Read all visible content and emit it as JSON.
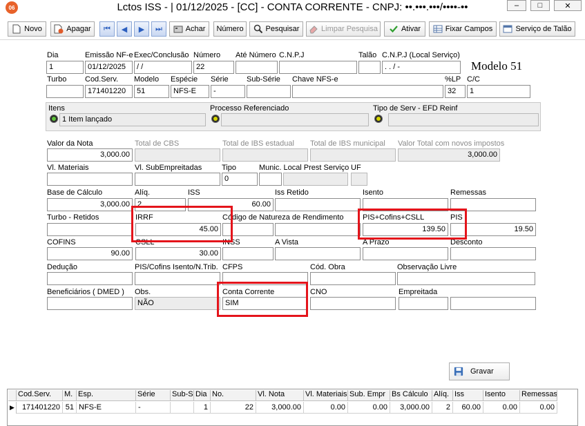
{
  "window": {
    "title": "Lctos ISS - |  01/12/2025 - [CC] - CONTA CORRENTE - CNPJ: ••.•••.•••/••••-••",
    "icon_label": "06",
    "minimize": "–",
    "maximize": "□",
    "close": "✕"
  },
  "toolbar": {
    "novo": "Novo",
    "apagar": "Apagar",
    "achar": "Achar",
    "numero": "Número",
    "pesquisar": "Pesquisar",
    "limpar": "Limpar Pesquisa",
    "ativar": "Ativar",
    "fixar": "Fixar Campos",
    "servico": "Serviço de Talão",
    "nav_first": "⏮",
    "nav_prev": "◀",
    "nav_next": "▶",
    "nav_last": "⏭"
  },
  "header": {
    "modelo_title": "Modelo 51",
    "labels": {
      "dia": "Dia",
      "emissao": "Emissão NF-e",
      "exec": "Exec/Conclusão",
      "numero": "Número",
      "ate_numero": "Até Número",
      "cnpj": "C.N.P.J",
      "talao": "Talão",
      "cnpj_local": "C.N.P.J (Local Serviço)",
      "turbo": "Turbo",
      "cod_serv": "Cod.Serv.",
      "modelo": "Modelo",
      "especie": "Espécie",
      "serie": "Série",
      "sub_serie": "Sub-Série",
      "chave": "Chave NFS-e",
      "plp": "%LP",
      "cc": "C/C"
    },
    "values": {
      "dia": "1",
      "emissao": "01/12/2025",
      "exec": " /  /",
      "numero": "22",
      "ate_numero": "",
      "cnpj": "",
      "talao": "",
      "cnpj_local": "  .    .    /    -",
      "turbo": "",
      "cod_serv": "171401220",
      "modelo": "51",
      "especie": "NFS-E",
      "serie": "-",
      "sub_serie": "",
      "chave": "",
      "plp": "32",
      "cc": "1"
    }
  },
  "itens": {
    "itens_label": "Itens",
    "itens_value": "1 Item lançado",
    "processo_label": "Processo Referenciado",
    "processo_value": "",
    "tipo_label": "Tipo de Serv - EFD Reinf",
    "tipo_value": ""
  },
  "totais": {
    "valor_nota_label": "Valor da Nota",
    "valor_nota": "3,000.00",
    "cbs_label": "Total de CBS",
    "cbs": "",
    "ibs_est_label": "Total de IBS estadual",
    "ibs_est": "",
    "ibs_mun_label": "Total de IBS municipal",
    "ibs_mun": "",
    "total_novos_label": "Valor Total com novos impostos",
    "total_novos": "3,000.00",
    "vl_mat_label": "Vl. Materiais",
    "vl_mat": "",
    "vl_sub_label": "Vl. SubEmpreitadas",
    "vl_sub": "",
    "tipo_label": "Tipo",
    "tipo": "0",
    "munic_label": "Munic. Local Prest Serviço",
    "munic": "",
    "uf_label": "UF",
    "uf": "",
    "base_label": "Base de Cálculo",
    "base": "3,000.00",
    "aliq_label": "Alíq.",
    "aliq": "2",
    "iss_label": "ISS",
    "iss": "60.00",
    "iss_retido_label": "Iss Retido",
    "iss_retido": "",
    "isento_label": "Isento",
    "isento": "",
    "remessas_label": "Remessas",
    "remessas": "",
    "turbo_ret_label": "Turbo - Retidos",
    "turbo_ret": "",
    "irrf_label": "IRRF",
    "irrf": "45.00",
    "cod_nat_label": "Código de Natureza de Rendimento",
    "cod_nat": "",
    "pcc_label": "PIS+Cofins+CSLL",
    "pcc": "139.50",
    "pis_label": "PIS",
    "pis": "19.50",
    "cofins_label": "COFINS",
    "cofins": "90.00",
    "csll_label": "CSLL",
    "csll": "30.00",
    "inss_label": "INSS",
    "inss": "",
    "avista_label": "A Vista",
    "avista": "",
    "aprazo_label": "A Prazo",
    "aprazo": "",
    "desconto_label": "Desconto",
    "desconto": "",
    "deducao_label": "Dedução",
    "deducao": "",
    "pis_isento_label": "PIS/Cofins Isento/N.Trib.",
    "pis_isento": "",
    "cfps_label": "CFPS",
    "cfps": "",
    "cod_obra_label": "Cód. Obra",
    "cod_obra": "",
    "obs_livre_label": "Observação Livre",
    "obs_livre": "",
    "benef_label": "Beneficiários ( DMED )",
    "benef": "",
    "obs_label": "Obs.",
    "obs": "NÃO",
    "conta_label": "Conta Corrente",
    "conta": "SIM",
    "cno_label": "CNO",
    "cno": "",
    "empreitada_label": "Empreitada",
    "empreitada": "",
    "empreitada2": ""
  },
  "actions": {
    "gravar": "Gravar"
  },
  "grid": {
    "columns": [
      "Cod.Serv.",
      "M.",
      "Esp.",
      "Série",
      "Sub-S",
      "Dia",
      "No.",
      "Vl. Nota",
      "Vl. Materiais",
      "Sub. Empr",
      "Bs Cálculo",
      "Alíq.",
      "Iss",
      "Isento",
      "Remessas"
    ],
    "row_marker": "▶",
    "row": [
      "171401220",
      "51",
      "NFS-E",
      "-",
      "",
      "1",
      "22",
      "3,000.00",
      "0.00",
      "0.00",
      "3,000.00",
      "2",
      "60.00",
      "0.00",
      "0.00"
    ]
  },
  "colors": {
    "highlight": "#e4141b",
    "accent": "#2c5fbf",
    "readonly": "#ececec"
  }
}
